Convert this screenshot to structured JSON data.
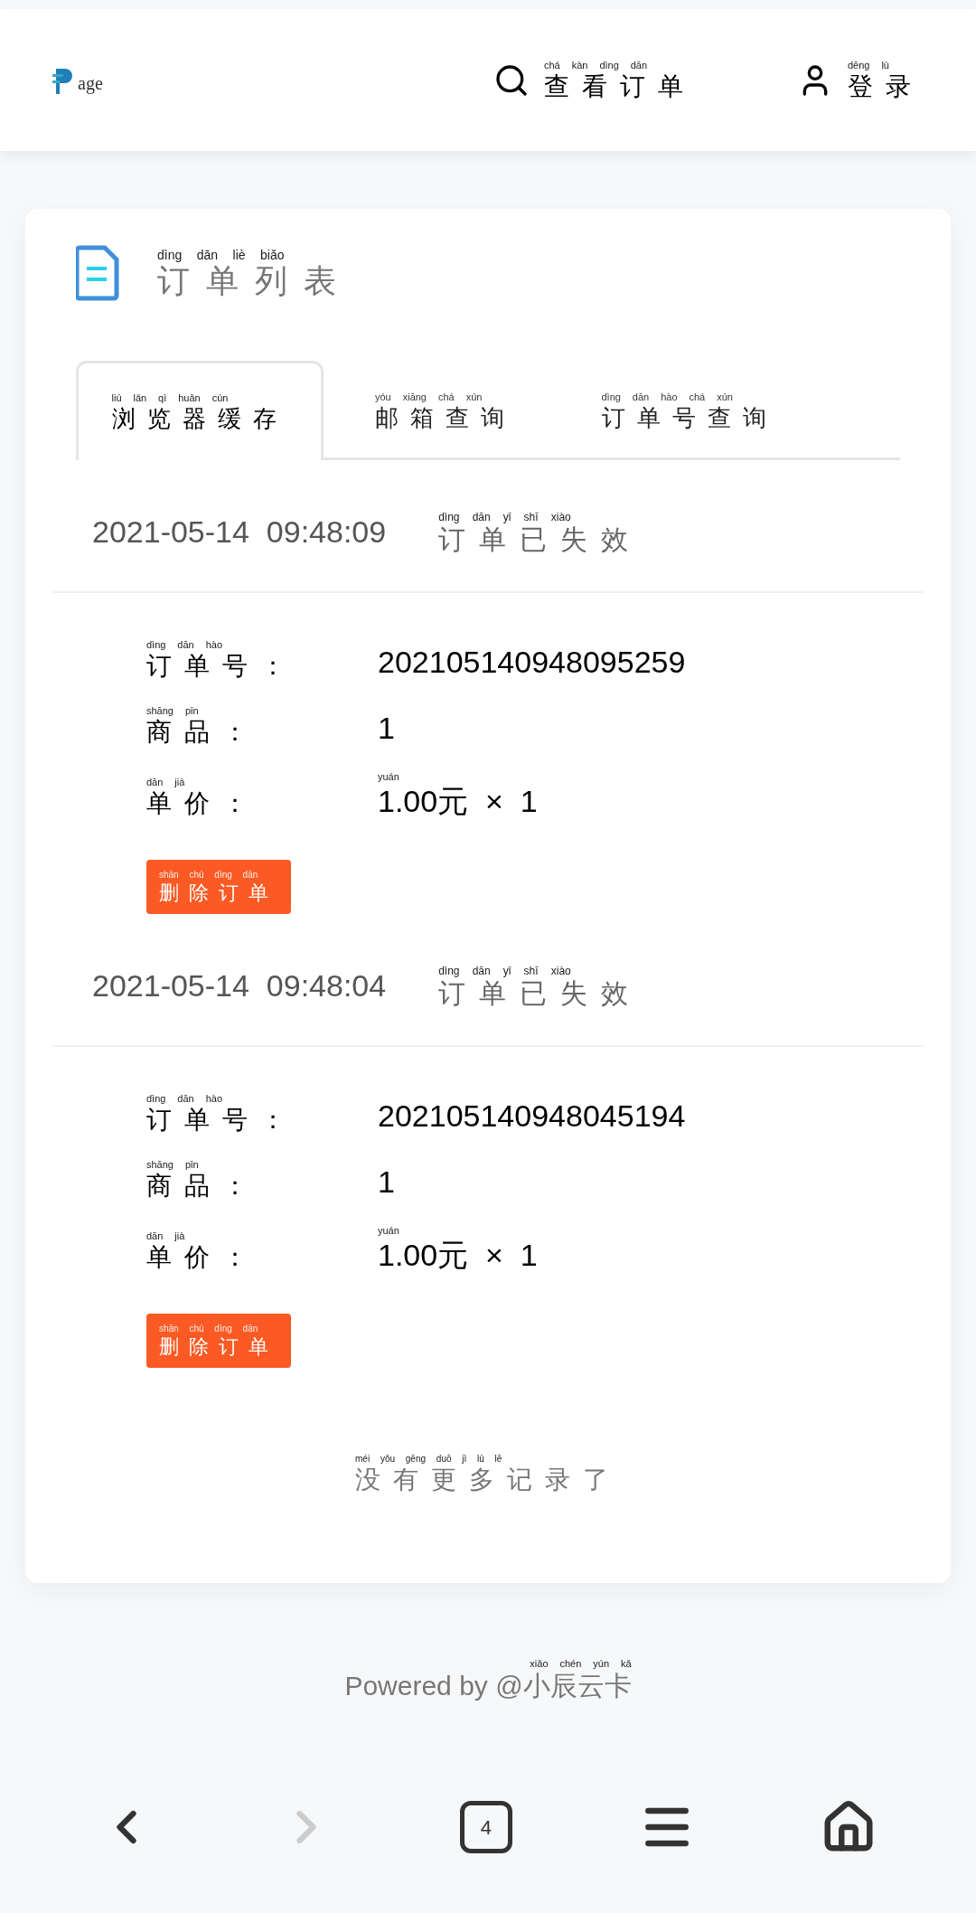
{
  "header": {
    "logo_text": "age",
    "links": [
      {
        "label": {
          "text": "查看订单",
          "pinyin": "chá kàn dìng dān"
        }
      },
      {
        "label": {
          "text": "登录",
          "pinyin": "dēng lù"
        }
      }
    ]
  },
  "card": {
    "title": {
      "text": "订单列表",
      "pinyin": "dìng dān liè biǎo"
    },
    "tabs": [
      {
        "label": {
          "text": "浏览器缓存",
          "pinyin": "liú lǎn qì huǎn cún"
        },
        "selected": true
      },
      {
        "label": {
          "text": "邮箱查询",
          "pinyin": "yóu xiāng chá xún"
        },
        "selected": false
      },
      {
        "label": {
          "text": "订单号查询",
          "pinyin": "dìng dān hào chá xún"
        },
        "selected": false
      }
    ],
    "orders": [
      {
        "time": "2021-05-14  09:48:09",
        "status": {
          "text": "订单已失效",
          "pinyin": "dìng dān yǐ shī xiào"
        },
        "fields": [
          {
            "label": {
              "text": "订单号：",
              "pinyin": "dìng dān hào"
            },
            "value": {
              "text": "202105140948095259"
            }
          },
          {
            "label": {
              "text": "商品：",
              "pinyin": "shāng pǐn"
            },
            "value": {
              "text": "1"
            }
          },
          {
            "label": {
              "text": "单价：",
              "pinyin": "dān jià"
            },
            "value": {
              "text": "1.00元  ×  1",
              "pinyin": "yuán"
            }
          }
        ],
        "button": {
          "text": "删除订单",
          "pinyin": "shān chú dìng dān"
        }
      },
      {
        "time": "2021-05-14  09:48:04",
        "status": {
          "text": "订单已失效",
          "pinyin": "dìng dān yǐ shī xiào"
        },
        "fields": [
          {
            "label": {
              "text": "订单号：",
              "pinyin": "dìng dān hào"
            },
            "value": {
              "text": "202105140948045194"
            }
          },
          {
            "label": {
              "text": "商品：",
              "pinyin": "shāng pǐn"
            },
            "value": {
              "text": "1"
            }
          },
          {
            "label": {
              "text": "单价：",
              "pinyin": "dān jià"
            },
            "value": {
              "text": "1.00元  ×  1",
              "pinyin": "yuán"
            }
          }
        ],
        "button": {
          "text": "删除订单",
          "pinyin": "shān chú dìng dān"
        }
      }
    ],
    "end_note": {
      "text": "没有更多记录了",
      "pinyin": "méi yǒu gēng duō jì lù lē"
    }
  },
  "footer": {
    "text": "Powered by @小辰云卡",
    "pinyin": "xiǎo chén yún kǎ"
  },
  "browser_nav": {
    "back_disabled": false,
    "forward_disabled": true,
    "tab_count": "4"
  }
}
